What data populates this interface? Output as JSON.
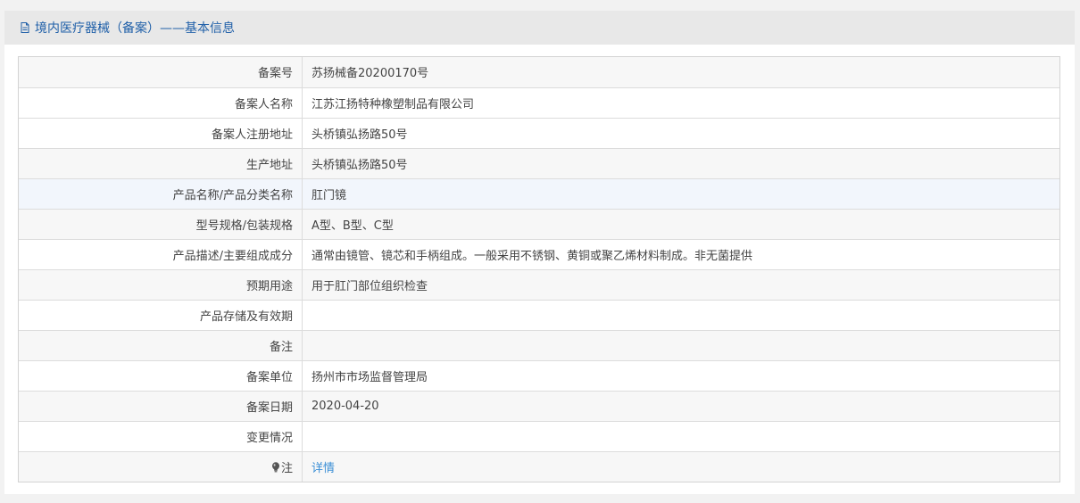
{
  "header": {
    "title": "境内医疗器械（备案）——基本信息"
  },
  "rows": [
    {
      "label": "备案号",
      "value": "苏扬械备20200170号"
    },
    {
      "label": "备案人名称",
      "value": "江苏江扬特种橡塑制品有限公司"
    },
    {
      "label": "备案人注册地址",
      "value": "头桥镇弘扬路50号"
    },
    {
      "label": "生产地址",
      "value": "头桥镇弘扬路50号"
    },
    {
      "label": "产品名称/产品分类名称",
      "value": "肛门镜"
    },
    {
      "label": "型号规格/包装规格",
      "value": "A型、B型、C型"
    },
    {
      "label": "产品描述/主要组成成分",
      "value": "通常由镜管、镜芯和手柄组成。一般采用不锈钢、黄铜或聚乙烯材料制成。非无菌提供"
    },
    {
      "label": "预期用途",
      "value": "用于肛门部位组织检查"
    },
    {
      "label": "产品存储及有效期",
      "value": ""
    },
    {
      "label": "备注",
      "value": ""
    },
    {
      "label": "备案单位",
      "value": "扬州市市场监督管理局"
    },
    {
      "label": "备案日期",
      "value": "2020-04-20"
    },
    {
      "label": "变更情况",
      "value": ""
    }
  ],
  "note": {
    "label": "注",
    "link_text": "详情",
    "icon": "bulb-icon"
  },
  "colors": {
    "title": "#1f5fa8",
    "link": "#3b8fd6"
  }
}
